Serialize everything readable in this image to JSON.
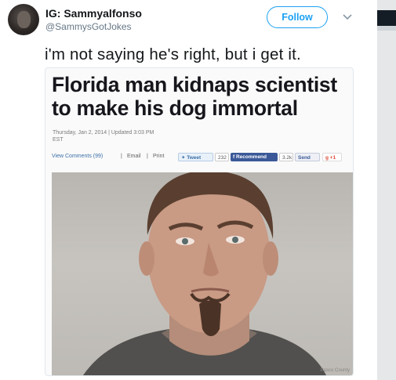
{
  "tweet": {
    "display_name": "IG: Sammyalfonso",
    "handle": "@SammysGotJokes",
    "follow_label": "Follow",
    "text": "i'm not saying he's right, but i get it."
  },
  "article": {
    "headline_line1": "Florida man kidnaps scientist",
    "headline_line2": "to make his dog immortal",
    "dateline_line1": "Thursday, Jan 2, 2014 | Updated 3:03 PM",
    "dateline_line2": "EST",
    "share_bar": {
      "view_comments": "View Comments (99)",
      "sep": "|",
      "email": "Email",
      "print": "Print",
      "tweet_label": "Tweet",
      "tweet_count": "232",
      "recommend_label": "Recommend",
      "recommend_count": "3.2k",
      "send_label": "Send",
      "gplus_label": "+1"
    },
    "photo_credit": "Pasco County"
  },
  "icons": {
    "caret": "chevron-down-icon",
    "tweet_bird": "twitter-bird-icon",
    "facebook": "facebook-icon"
  },
  "colors": {
    "accent": "#1da1f2",
    "facebook": "#3b5998"
  }
}
